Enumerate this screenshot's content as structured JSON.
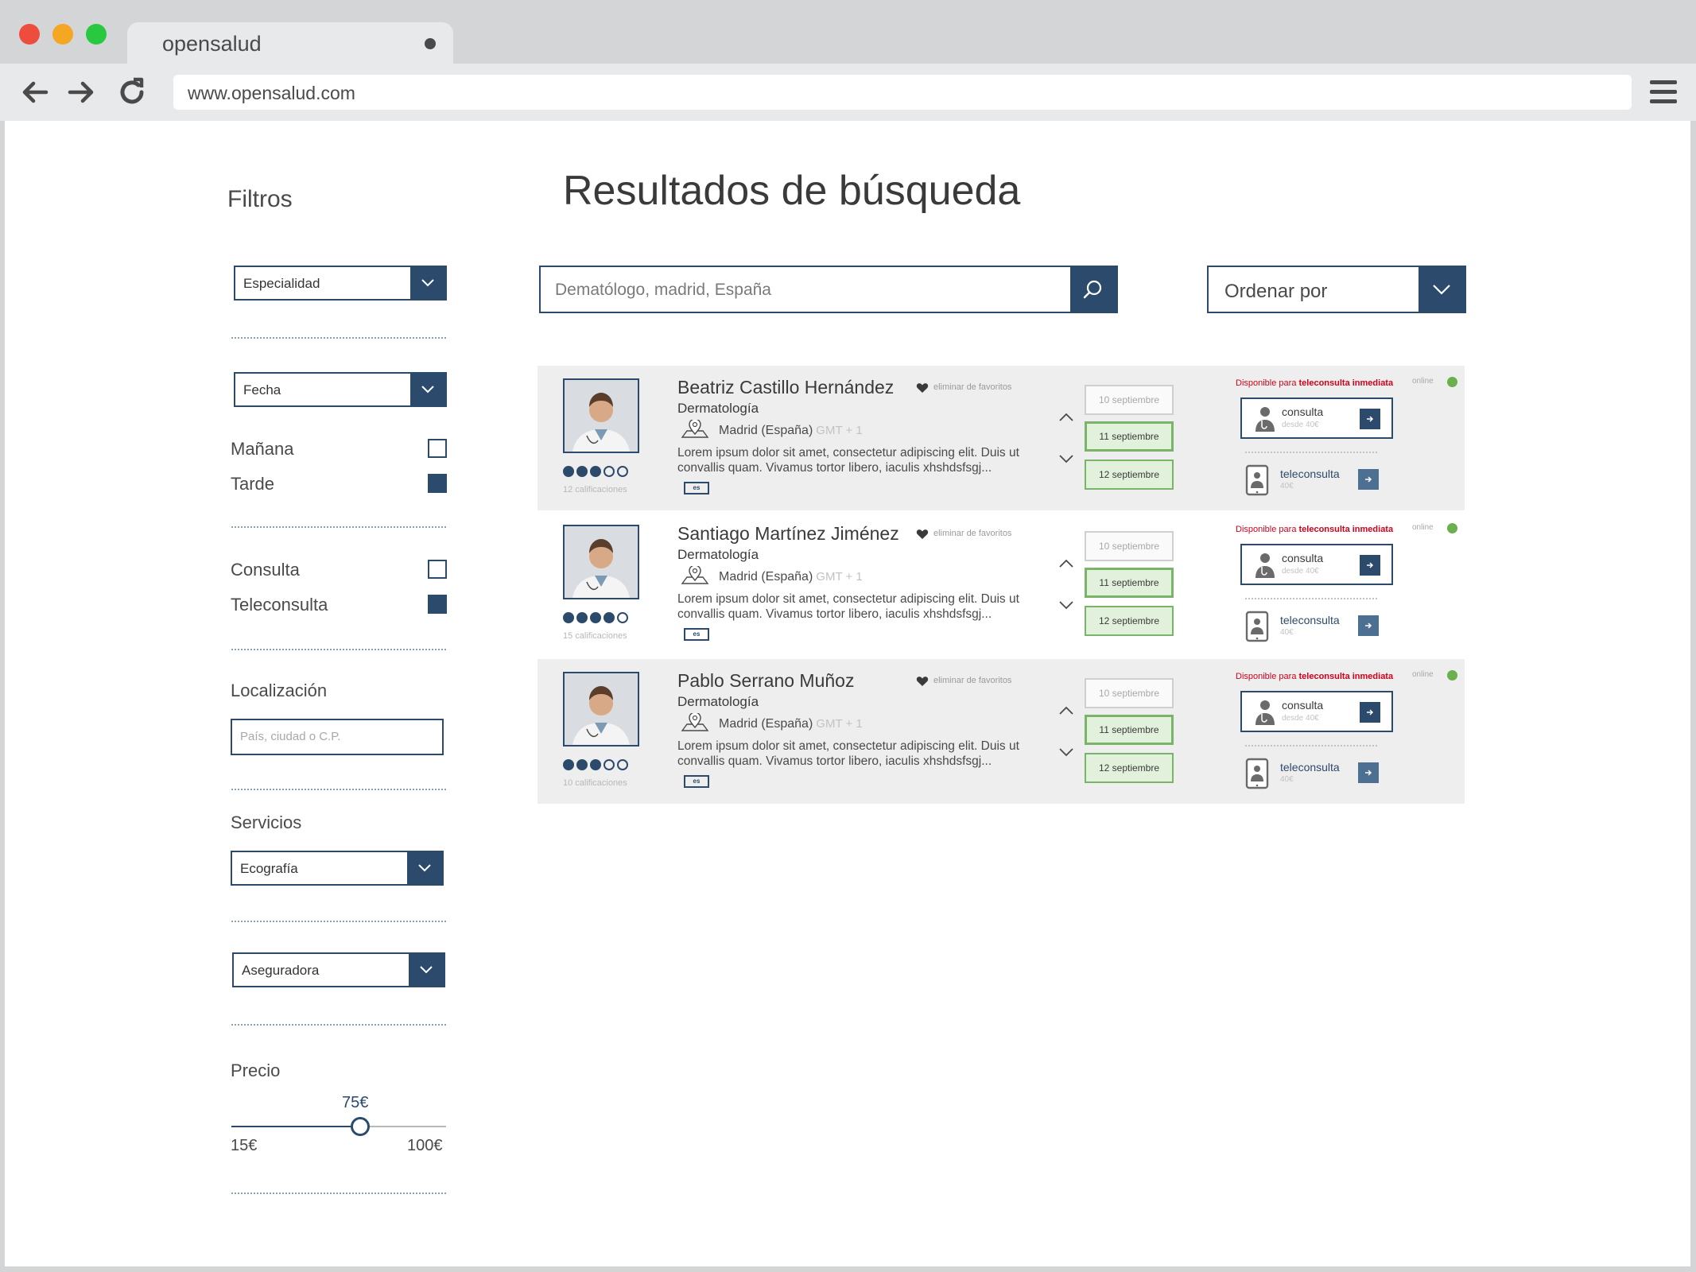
{
  "browser": {
    "tab_title": "opensalud",
    "url": "www.opensalud.com"
  },
  "sidebar": {
    "title": "Filtros",
    "specialty_select": "Especialidad",
    "date_select": "Fecha",
    "time_options": [
      {
        "label": "Mañana",
        "checked": false
      },
      {
        "label": "Tarde",
        "checked": true
      }
    ],
    "type_options": [
      {
        "label": "Consulta",
        "checked": false
      },
      {
        "label": "Teleconsulta",
        "checked": true
      }
    ],
    "location": {
      "label": "Localización",
      "placeholder": "País, ciudad o C.P."
    },
    "services": {
      "label": "Servicios",
      "selected": "Ecografía"
    },
    "insurer_select": "Aseguradora",
    "price": {
      "label": "Precio",
      "value": "75€",
      "min": "15€",
      "max": "100€",
      "fraction": 0.6
    }
  },
  "main": {
    "title": "Resultados de búsqueda",
    "search_placeholder": "Dematólogo, madrid, España",
    "order_label": "Ordenar por"
  },
  "results": [
    {
      "name": "Beatriz Castillo Hernández",
      "favorite": "eliminar de favoritos",
      "specialty": "Dermatología",
      "city": "Madrid (España)",
      "gmt": "GMT + 1",
      "description": "Lorem ipsum dolor sit amet, consectetur adipiscing elit. Duis ut convallis quam. Vivamus tortor libero, iaculis xhshdsfsgj...",
      "language": "es",
      "rating": 3,
      "reviews": "12 calificaciones",
      "dates": [
        "10 septiembre",
        "11 septiembre",
        "12 septiembre"
      ],
      "availability_prefix": "Disponible para",
      "availability_bold": "teleconsulta inmediata",
      "status": "online",
      "service1": {
        "name": "consulta",
        "price": "desde 40€"
      },
      "service2": {
        "name": "teleconsulta",
        "price": "40€"
      }
    },
    {
      "name": "Santiago Martínez Jiménez",
      "favorite": "eliminar de favoritos",
      "specialty": "Dermatología",
      "city": "Madrid (España)",
      "gmt": "GMT + 1",
      "description": "Lorem ipsum dolor sit amet, consectetur adipiscing elit. Duis ut convallis quam. Vivamus tortor libero, iaculis xhshdsfsgj...",
      "language": "es",
      "rating": 4,
      "reviews": "15 calificaciones",
      "dates": [
        "10 septiembre",
        "11 septiembre",
        "12 septiembre"
      ],
      "availability_prefix": "Disponible para",
      "availability_bold": "teleconsulta inmediata",
      "status": "online",
      "service1": {
        "name": "consulta",
        "price": "desde 40€"
      },
      "service2": {
        "name": "teleconsulta",
        "price": "40€"
      }
    },
    {
      "name": "Pablo Serrano Muñoz",
      "favorite": "eliminar de favoritos",
      "specialty": "Dermatología",
      "city": "Madrid (España)",
      "gmt": "GMT + 1",
      "description": "Lorem ipsum dolor sit amet, consectetur adipiscing elit. Duis ut convallis quam. Vivamus tortor libero, iaculis xhshdsfsgj...",
      "language": "es",
      "rating": 3,
      "reviews": "10 calificaciones",
      "dates": [
        "10 septiembre",
        "11 septiembre",
        "12 septiembre"
      ],
      "availability_prefix": "Disponible para",
      "availability_bold": "teleconsulta inmediata",
      "status": "online",
      "service1": {
        "name": "consulta",
        "price": "desde 40€"
      },
      "service2": {
        "name": "teleconsulta",
        "price": "40€"
      }
    }
  ],
  "colors": {
    "primary": "#2c4a6b",
    "available_green": "#7ab469",
    "online_dot": "#6ab04c",
    "alert_red": "#d0021b"
  }
}
